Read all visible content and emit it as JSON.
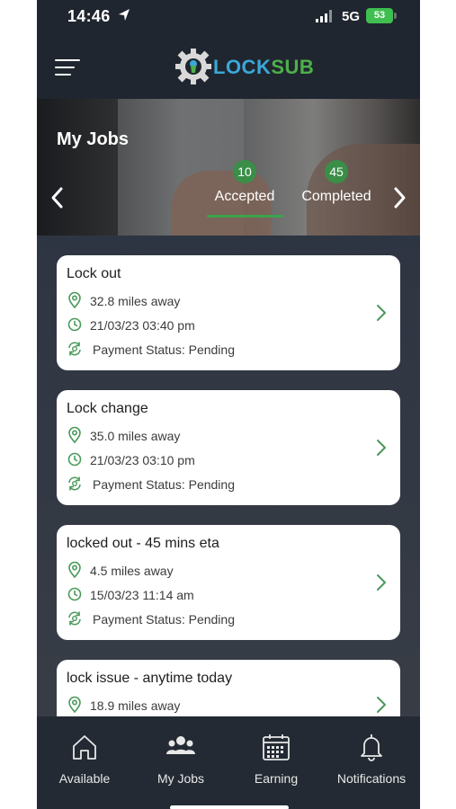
{
  "status_bar": {
    "time": "14:46",
    "network": "5G",
    "battery": "53"
  },
  "header": {
    "logo_part1": "LOCK",
    "logo_part2": "SUB"
  },
  "hero": {
    "title": "My Jobs",
    "tabs": [
      {
        "label": "Accepted",
        "count": "10",
        "active": true
      },
      {
        "label": "Completed",
        "count": "45",
        "active": false
      }
    ]
  },
  "jobs": [
    {
      "title": "Lock out",
      "distance": "32.8 miles away",
      "datetime": "21/03/23 03:40 pm",
      "payment": "Payment Status: Pending"
    },
    {
      "title": "Lock change",
      "distance": "35.0 miles away",
      "datetime": "21/03/23 03:10 pm",
      "payment": "Payment Status: Pending"
    },
    {
      "title": "locked out - 45 mins eta",
      "distance": "4.5 miles away",
      "datetime": "15/03/23 11:14 am",
      "payment": "Payment Status: Pending"
    },
    {
      "title": "lock issue - anytime today",
      "distance": "18.9 miles away"
    }
  ],
  "bottom_nav": [
    {
      "label": "Available",
      "icon": "home-icon"
    },
    {
      "label": "My Jobs",
      "icon": "group-icon"
    },
    {
      "label": "Earning",
      "icon": "calendar-icon"
    },
    {
      "label": "Notifications",
      "icon": "bell-icon"
    }
  ],
  "colors": {
    "accent_green": "#3a8e47",
    "logo_blue": "#3aa8d8",
    "icon_green": "#4a9a5a"
  }
}
